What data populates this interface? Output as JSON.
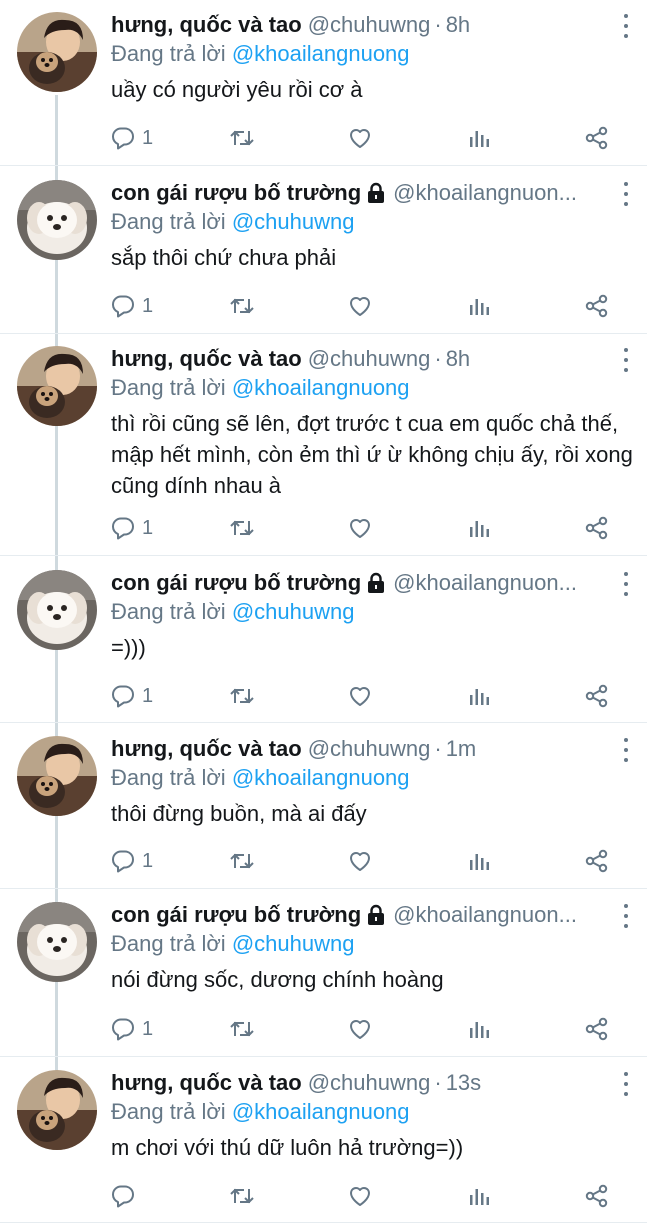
{
  "tweets": [
    {
      "name": "hưng, quốc và tao",
      "locked": false,
      "handle": "@chuhuwng",
      "time": "8h",
      "replying_label": "Đang trả lời",
      "replying_to": "@khoailangnuong",
      "text": "uầy có người yêu rồi cơ à",
      "reply_count": "1",
      "avatar": "boy-avatar"
    },
    {
      "name": "con gái rượu bố trường",
      "locked": true,
      "handle": "@khoailangnuon...",
      "time": "",
      "replying_label": "Đang trả lời",
      "replying_to": "@chuhuwng",
      "text": "sắp thôi chứ chưa phải",
      "reply_count": "1",
      "avatar": "dog-avatar"
    },
    {
      "name": "hưng, quốc và tao",
      "locked": false,
      "handle": "@chuhuwng",
      "time": "8h",
      "replying_label": "Đang trả lời",
      "replying_to": "@khoailangnuong",
      "text": "thì rồi cũng sẽ lên, đợt trước t cua em quốc chả thế, mập hết mình, còn ẻm thì ứ ừ không chịu ấy, rồi xong cũng dính nhau à",
      "reply_count": "1",
      "avatar": "boy-avatar"
    },
    {
      "name": "con gái rượu bố trường",
      "locked": true,
      "handle": "@khoailangnuon...",
      "time": "",
      "replying_label": "Đang trả lời",
      "replying_to": "@chuhuwng",
      "text": "=)))",
      "reply_count": "1",
      "avatar": "dog-avatar"
    },
    {
      "name": "hưng, quốc và tao",
      "locked": false,
      "handle": "@chuhuwng",
      "time": "1m",
      "replying_label": "Đang trả lời",
      "replying_to": "@khoailangnuong",
      "text": "thôi đừng buồn, mà ai đấy",
      "reply_count": "1",
      "avatar": "boy-avatar"
    },
    {
      "name": "con gái rượu bố trường",
      "locked": true,
      "handle": "@khoailangnuon...",
      "time": "",
      "replying_label": "Đang trả lời",
      "replying_to": "@chuhuwng",
      "text": "nói đừng sốc, dương chính hoàng",
      "reply_count": "1",
      "avatar": "dog-avatar"
    },
    {
      "name": "hưng, quốc và tao",
      "locked": false,
      "handle": "@chuhuwng",
      "time": "13s",
      "replying_label": "Đang trả lời",
      "replying_to": "@khoailangnuong",
      "text": "m chơi với thú dữ luôn hả trường=))",
      "reply_count": "",
      "avatar": "boy-avatar"
    }
  ],
  "icons": {
    "reply": "speech-bubble-icon",
    "retweet": "retweet-icon",
    "like": "heart-icon",
    "analytics": "bar-chart-icon",
    "share": "share-icon",
    "more": "vertical-dots-icon",
    "lock": "lock-icon"
  },
  "colors": {
    "link": "#1da1f2",
    "muted": "#657786",
    "text": "#14171a",
    "thread_line": "#cfd9de"
  }
}
